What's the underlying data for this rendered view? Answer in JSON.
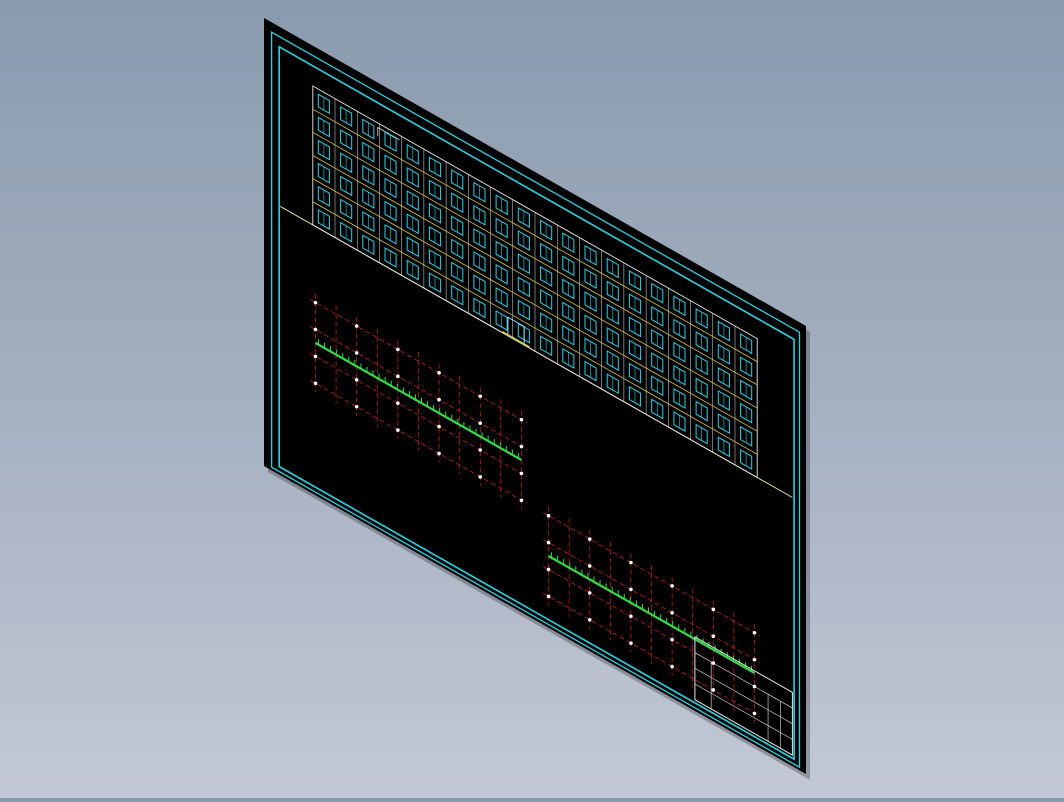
{
  "viewport": {
    "background_top": "#8a9aae",
    "background_bottom": "#c3c8d4",
    "projection": "isometric"
  },
  "sheet": {
    "background": "#000000",
    "border_color": "#27d3e3"
  },
  "elevation": {
    "line_color": "#e8e8e8",
    "window_color": "#29d3e8",
    "floor_band_color": "#d9c646",
    "ground_line_color": "#e0e0a0",
    "floors": 6,
    "bays": 20
  },
  "plans": {
    "grid_color": "#e02020",
    "node_color": "#ffffff",
    "wall_color": "#33dd44",
    "count": 2,
    "rows": 3,
    "cols": 10
  },
  "title_block": {
    "line_color": "#e6e6e6",
    "rows": 4
  },
  "colors": {
    "cyan": "#27d3e3",
    "red": "#e02020",
    "green": "#33dd44",
    "yellow": "#d9c646",
    "white": "#ffffff"
  }
}
